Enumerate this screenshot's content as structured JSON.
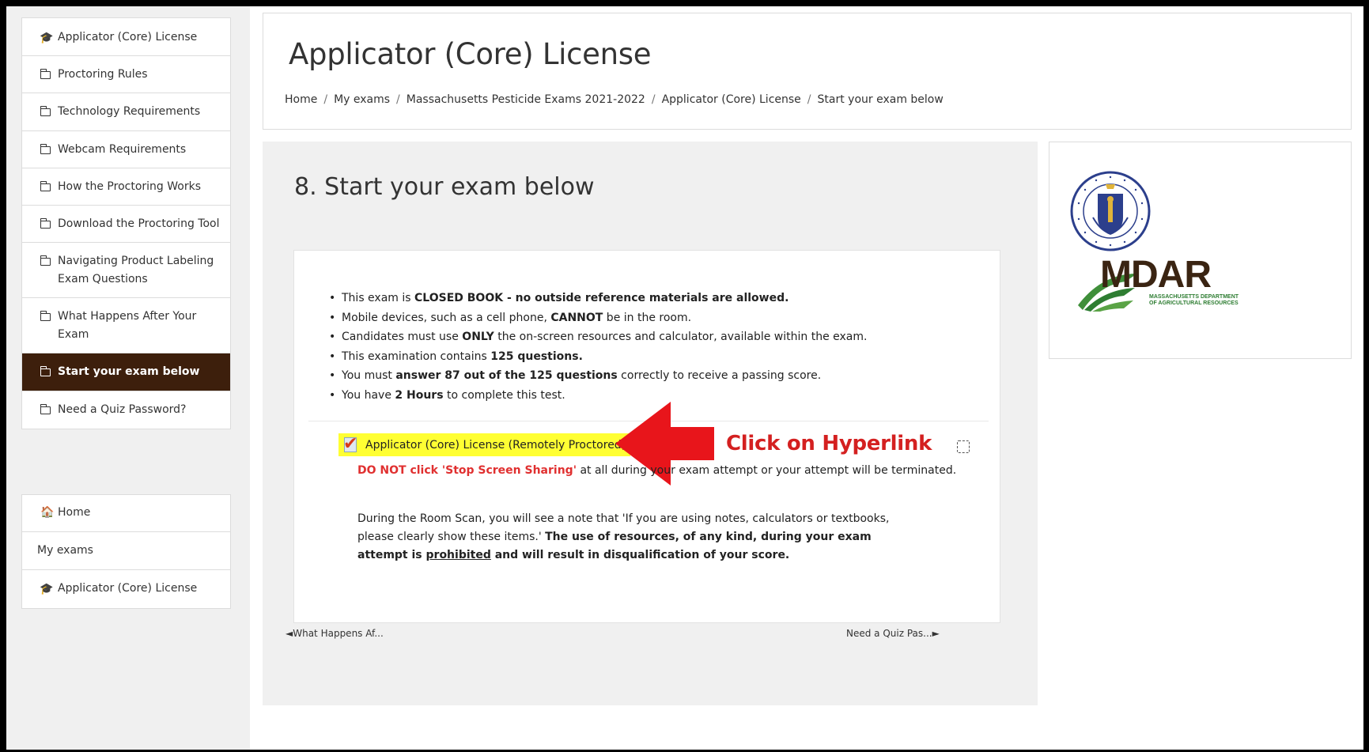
{
  "course_nav": {
    "items": [
      {
        "label": "Applicator (Core) License",
        "icon": "graduation-cap-icon"
      },
      {
        "label": "Proctoring Rules",
        "icon": "folder-icon"
      },
      {
        "label": "Technology Requirements",
        "icon": "folder-icon"
      },
      {
        "label": "Webcam Requirements",
        "icon": "folder-icon"
      },
      {
        "label": "How the Proctoring Works",
        "icon": "folder-icon"
      },
      {
        "label": "Download the Proctoring Tool",
        "icon": "folder-icon"
      },
      {
        "label": "Navigating Product Labeling Exam Questions",
        "icon": "folder-icon"
      },
      {
        "label": "What Happens After Your Exam",
        "icon": "folder-icon"
      },
      {
        "label": "Start your exam below",
        "icon": "folder-icon",
        "active": true
      },
      {
        "label": "Need a Quiz Password?",
        "icon": "folder-icon"
      }
    ]
  },
  "site_nav": {
    "items": [
      {
        "label": "Home",
        "icon": "home-icon"
      },
      {
        "label": "My exams"
      },
      {
        "label": "Applicator (Core) License",
        "icon": "graduation-cap-icon"
      }
    ]
  },
  "header": {
    "title": "Applicator (Core) License",
    "breadcrumb": [
      "Home",
      "My exams",
      "Massachusetts Pesticide Exams 2021-2022",
      "Applicator (Core) License",
      "Start your exam below"
    ]
  },
  "section": {
    "title": "8. Start your exam below"
  },
  "rules": {
    "r1_a": "This exam is ",
    "r1_b": "CLOSED BOOK - no outside reference materials are allowed.",
    "r2_a": "Mobile devices, such as a cell phone, ",
    "r2_b": "CANNOT",
    "r2_c": " be in the room.",
    "r3_a": "Candidates must use ",
    "r3_b": "ONLY",
    "r3_c": " the on-screen resources and calculator, available within the exam.",
    "r4_a": "This examination contains ",
    "r4_b": "125 questions.",
    "r5_a": "You must ",
    "r5_b": "answer 87 out of the 125 questions",
    "r5_c": " correctly to receive a passing score.",
    "r6_a": "You have ",
    "r6_b": "2 Hours",
    "r6_c": " to complete this test."
  },
  "activity": {
    "link_text": "Applicator (Core) License (Remotely Proctored)",
    "highlight_color": "#ffff33",
    "callout": "Click on Hyperlink",
    "callout_color": "#d42020"
  },
  "warning": {
    "red": "DO NOT click 'Stop Screen Sharing'",
    "rest": " at all during your exam attempt or your attempt will be terminated."
  },
  "room_scan": {
    "a": "During the Room Scan, you will see a note that 'If you are using notes, calculators or textbooks, please clearly show these items.' ",
    "b": "The use of resources, of any kind, during your exam attempt is ",
    "c": "prohibited",
    "d": " and will result in disqualification of your score."
  },
  "pager": {
    "prev": "◄What Happens Af...",
    "next": "Need a Quiz Pas...►"
  },
  "logos": {
    "mdar": "MDAR",
    "mdar_sub": "MASSACHUSETTS DEPARTMENT OF AGRICULTURAL RESOURCES",
    "seal_text": "SIGILLUM REIPUBLICAE MASSACHUSETTENSIS"
  },
  "colors": {
    "active_nav_bg": "#3d1f0c",
    "mdar_brown": "#3a2412",
    "mdar_green": "#2e7d32"
  }
}
